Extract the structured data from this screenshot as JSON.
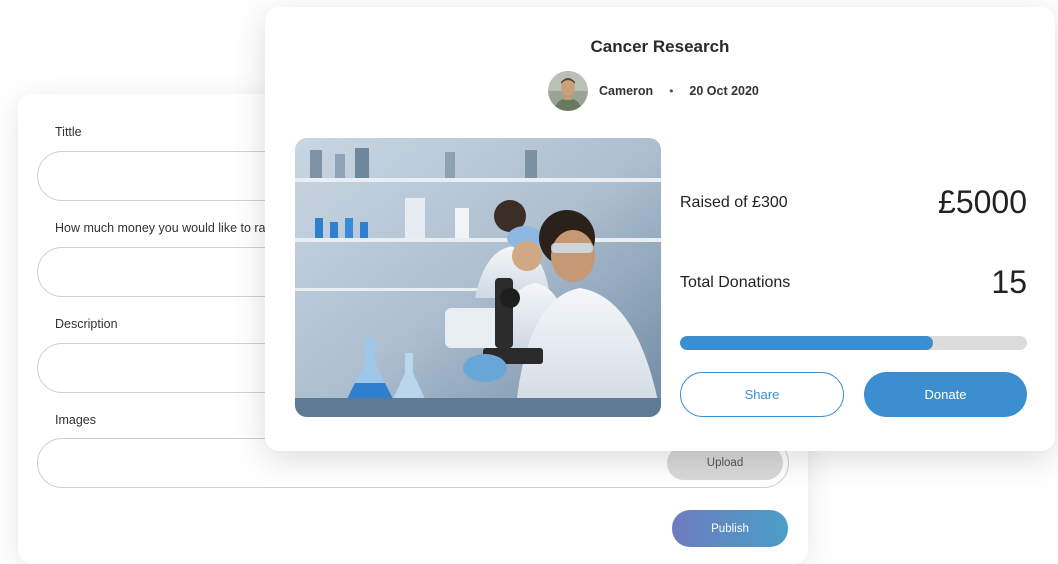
{
  "form": {
    "fields": [
      {
        "label": "Tittle",
        "value": ""
      },
      {
        "label": "How much money you would like to raise",
        "value": ""
      },
      {
        "label": "Description",
        "value": ""
      },
      {
        "label": "Images",
        "value": ""
      }
    ],
    "upload_label": "Upload",
    "publish_label": "Publish"
  },
  "campaign": {
    "title": "Cancer Research",
    "author": "Cameron",
    "separator": "•",
    "date": "20 Oct 2020",
    "image_icon": "lab-scientists-photo",
    "raised_label": "Raised of £300",
    "raised_value": "£5000",
    "donations_label": "Total Donations",
    "donations_value": "15",
    "progress_fraction": 0.73,
    "share_label": "Share",
    "donate_label": "Donate"
  },
  "colors": {
    "accent": "#3b8fd1",
    "publish_gradient_start": "#6e7bbf",
    "publish_gradient_end": "#4a9fc6",
    "track": "#dcdcdc"
  }
}
